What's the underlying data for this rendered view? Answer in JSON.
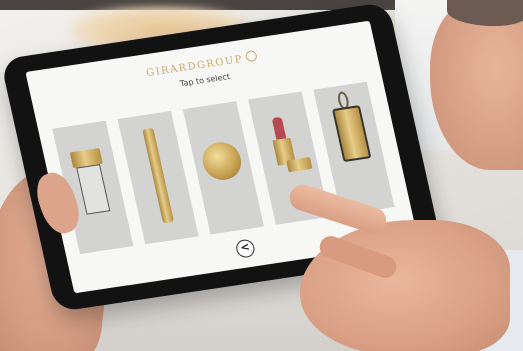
{
  "screen": {
    "brand": "GIRARDGROUP",
    "instruction": "Tap to select",
    "back_symbol": "<"
  },
  "products": [
    {
      "icon": "gold-cube-glass-display-icon"
    },
    {
      "icon": "gold-bar-icon"
    },
    {
      "icon": "gold-compact-icon"
    },
    {
      "icon": "lipstick-gold-case-icon"
    },
    {
      "icon": "gold-tag-pendant-icon"
    }
  ],
  "colors": {
    "accent_gold": "#c8a86b",
    "tablet_bezel": "#121212",
    "screen_bg": "#f7f7f6"
  }
}
